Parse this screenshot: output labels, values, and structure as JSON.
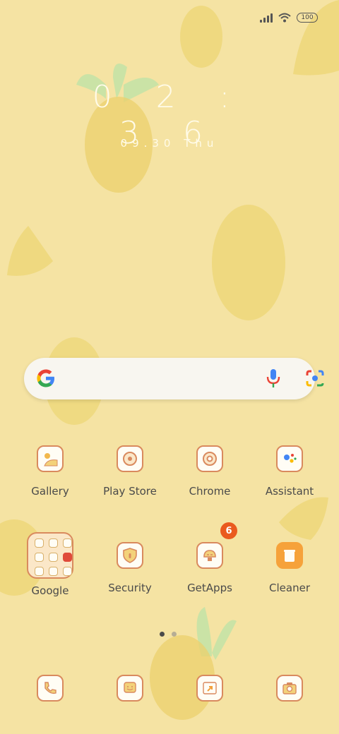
{
  "status_bar": {
    "battery": "100",
    "icons": [
      "signal-icon",
      "wifi-icon",
      "battery-icon"
    ]
  },
  "clock": {
    "time": "02:36",
    "time_display": "0 2 : 3 6",
    "date": "09.30",
    "weekday": "Thu"
  },
  "search_bar": {
    "icons": [
      "google-g-icon",
      "microphone-icon",
      "google-lens-icon"
    ]
  },
  "apps": [
    {
      "label": "Gallery",
      "icon": "gallery-icon"
    },
    {
      "label": "Play Store",
      "icon": "play-store-icon"
    },
    {
      "label": "Chrome",
      "icon": "chrome-icon"
    },
    {
      "label": "Assistant",
      "icon": "assistant-icon"
    },
    {
      "label": "Google",
      "icon": "folder-icon"
    },
    {
      "label": "Security",
      "icon": "security-icon"
    },
    {
      "label": "GetApps",
      "icon": "getapps-icon",
      "badge": "6"
    },
    {
      "label": "Cleaner",
      "icon": "cleaner-icon"
    }
  ],
  "dock": [
    {
      "icon": "phone-icon"
    },
    {
      "icon": "messages-icon"
    },
    {
      "icon": "browser-icon"
    },
    {
      "icon": "camera-icon"
    }
  ],
  "page_indicator": {
    "pages": 2,
    "current": 1
  },
  "colors": {
    "wallpaper": "#f5e3a3",
    "icon_outline": "#d98a5e",
    "badge": "#ea5a1e"
  }
}
